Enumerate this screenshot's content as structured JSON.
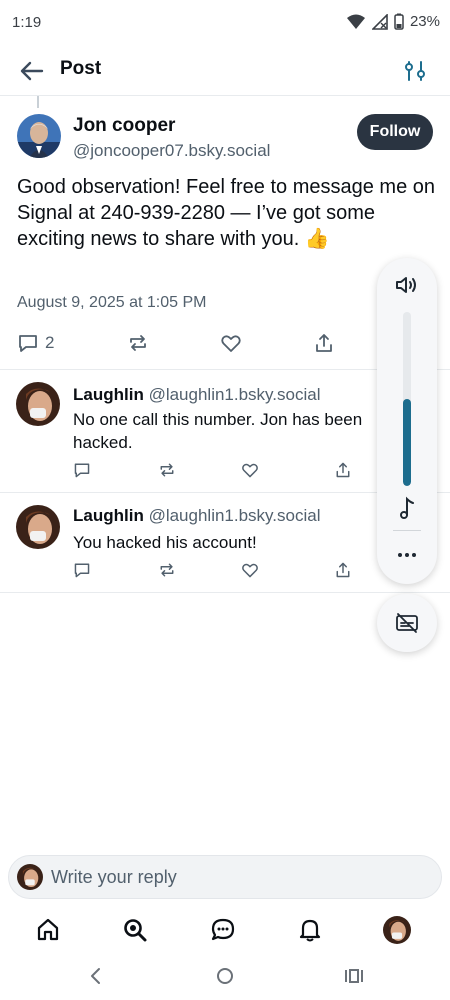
{
  "status_bar": {
    "time": "1:19",
    "battery": "23%"
  },
  "header": {
    "title": "Post"
  },
  "post": {
    "author_name": "Jon cooper",
    "author_handle": "@joncooper07.bsky.social",
    "follow_label": "Follow",
    "text": "Good observation! Feel free to message me on Signal at 240-939-2280 — I’ve got some exciting news to share with you. 👍",
    "date": "August 9, 2025 at 1:05 PM",
    "reply_count": "2"
  },
  "replies": [
    {
      "name": "Laughlin",
      "handle": "@laughlin1.bsky.social",
      "text": "No one call this number. Jon has been hacked."
    },
    {
      "name": "Laughlin",
      "handle": "@laughlin1.bsky.social",
      "text": "You hacked his account!"
    }
  ],
  "volume": {
    "level": 0.5,
    "accent": "#1d6d8e"
  },
  "composer": {
    "placeholder": "Write your reply"
  },
  "icons": {
    "back": "arrow-left-icon",
    "filter": "sliders-icon",
    "reply": "comment-icon",
    "repost": "repost-icon",
    "like": "heart-icon",
    "share": "share-icon",
    "home": "home-icon",
    "search": "search-icon",
    "chat": "chat-icon",
    "notifications": "bell-icon"
  }
}
